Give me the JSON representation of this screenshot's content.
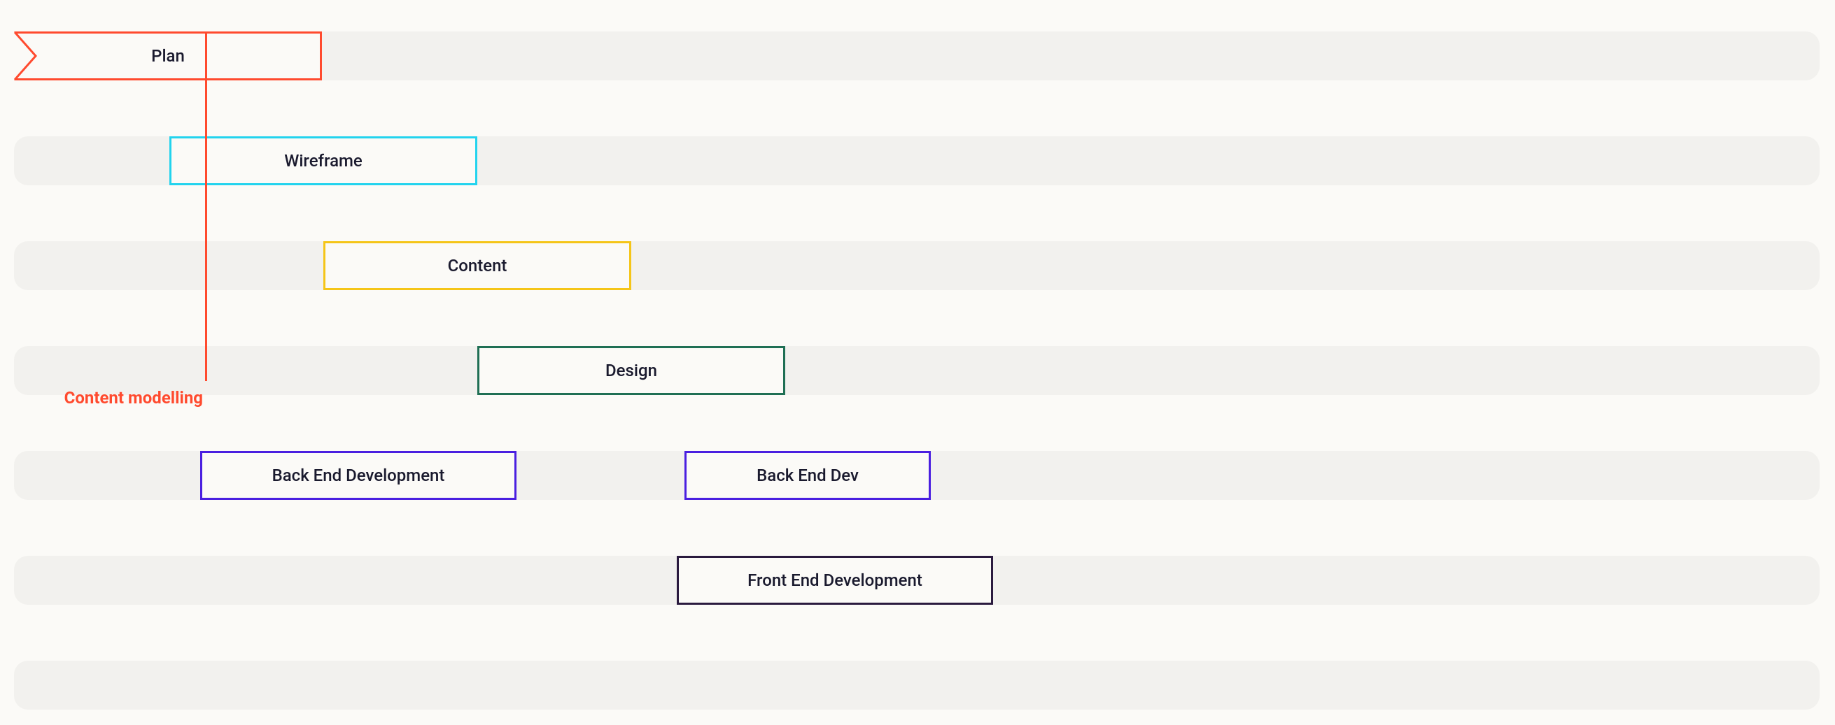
{
  "chart_data": {
    "type": "gantt",
    "unit": "time-step",
    "x_range": [
      0,
      12
    ],
    "marker": {
      "label": "Content modelling",
      "x": 1.25
    },
    "tasks": [
      {
        "id": "plan",
        "label": "Plan",
        "row": 0,
        "start": 0.0,
        "end": 2.0,
        "color": "#ff4a2e",
        "shape": "chevron"
      },
      {
        "id": "wireframe",
        "label": "Wireframe",
        "row": 1,
        "start": 1.05,
        "end": 3.05,
        "color": "#22d3ee",
        "shape": "rect"
      },
      {
        "id": "content",
        "label": "Content",
        "row": 2,
        "start": 2.05,
        "end": 4.05,
        "color": "#f5c518",
        "shape": "rect"
      },
      {
        "id": "design",
        "label": "Design",
        "row": 3,
        "start": 3.05,
        "end": 5.05,
        "color": "#1f6f54",
        "shape": "rect"
      },
      {
        "id": "bed1",
        "label": "Back End Development",
        "row": 4,
        "start": 1.25,
        "end": 3.3,
        "color": "#4a1fe0",
        "shape": "rect"
      },
      {
        "id": "bed2",
        "label": "Back End Dev",
        "row": 4,
        "start": 4.4,
        "end": 6.0,
        "color": "#4a1fe0",
        "shape": "rect"
      },
      {
        "id": "fed",
        "label": "Front End Development",
        "row": 5,
        "start": 4.35,
        "end": 6.4,
        "color": "#2a1a3e",
        "shape": "rect"
      }
    ]
  },
  "colors": {
    "track": "#f2f1ee",
    "page": "#fbfaf7",
    "marker": "#ff4a2e"
  }
}
